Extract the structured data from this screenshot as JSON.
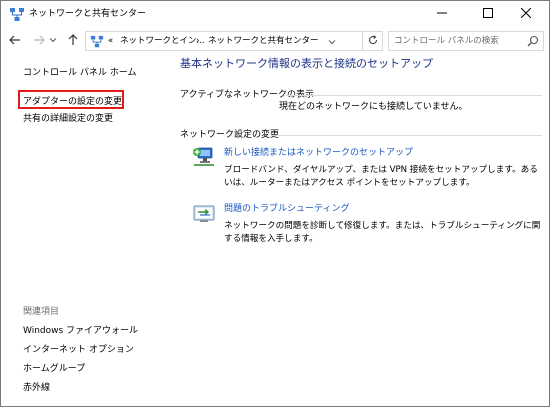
{
  "window": {
    "title": "ネットワークと共有センター"
  },
  "address": {
    "overflow": "«",
    "segment1": "ネットワークとイン...",
    "separator": "›",
    "segment2": "ネットワークと共有センター",
    "search_placeholder": "コントロール パネルの検索"
  },
  "sidebar": {
    "home": "コントロール パネル ホーム",
    "adapter_settings": "アダプターの設定の変更",
    "advanced_sharing": "共有の詳細設定の変更",
    "related_heading": "関連項目",
    "related": {
      "firewall": "Windows ファイアウォール",
      "internet_options": "インターネット オプション",
      "homegroup": "ホームグループ",
      "infrared": "赤外線"
    }
  },
  "main": {
    "title": "基本ネットワーク情報の表示と接続のセットアップ",
    "active_heading": "アクティブなネットワークの表示",
    "no_connection": "現在どのネットワークにも接続していません。",
    "settings_heading": "ネットワーク設定の変更",
    "tasks": {
      "new_connection": {
        "label": "新しい接続またはネットワークのセットアップ",
        "description": "ブロードバンド、ダイヤルアップ、または VPN 接続をセットアップします。あるいは、ルーターまたはアクセス ポイントをセットアップします。"
      },
      "troubleshoot": {
        "label": "問題のトラブルシューティング",
        "description": "ネットワークの問題を診断して修復します。または、トラブルシューティングに関する情報を入手します。"
      }
    }
  },
  "colors": {
    "link": "#1b55c0",
    "title": "#1e3287",
    "highlight": "#e21b1b",
    "muted": "#6d6d6d"
  },
  "icons": {
    "app": "network-sharing-icon",
    "minimize": "minimize-icon",
    "maximize": "maximize-icon",
    "close": "close-icon",
    "back": "arrow-left-icon",
    "forward": "arrow-right-icon",
    "up": "arrow-up-icon",
    "refresh": "refresh-icon",
    "search": "search-icon",
    "new_connection": "network-setup-icon",
    "troubleshoot": "troubleshoot-icon"
  }
}
